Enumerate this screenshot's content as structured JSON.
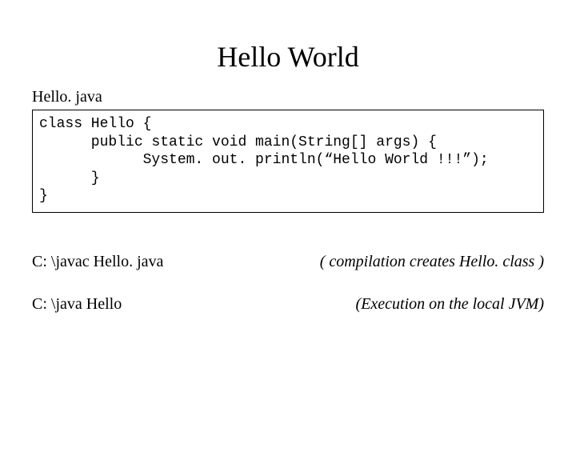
{
  "title": "Hello World",
  "filename": "Hello. java",
  "code": "class Hello {\n      public static void main(String[] args) {\n            System. out. println(“Hello World !!!”);\n      }\n}",
  "commands": [
    {
      "cmd": "C: \\javac Hello. java",
      "note": "( compilation creates Hello. class )"
    },
    {
      "cmd": "C: \\java Hello",
      "note": "(Execution on the local JVM)"
    }
  ]
}
